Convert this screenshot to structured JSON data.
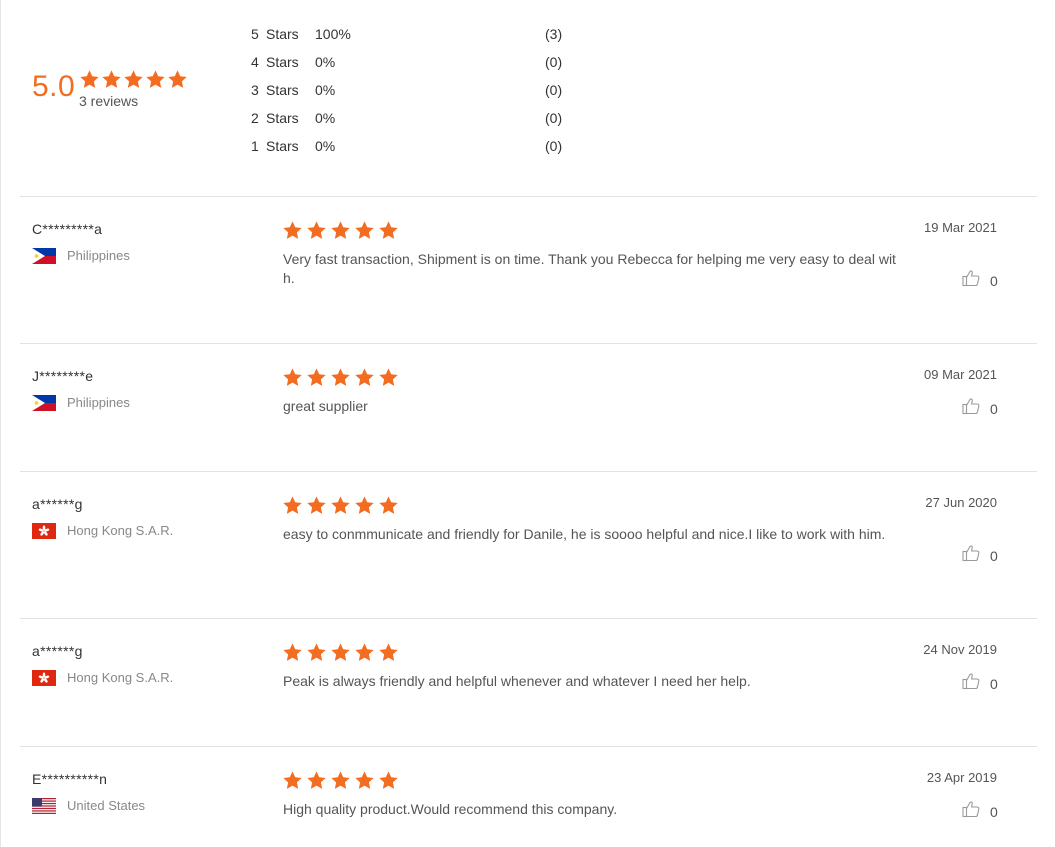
{
  "summary": {
    "score": "5.0",
    "rating": 5,
    "reviews_label": "3 reviews",
    "distribution": [
      {
        "stars": "5",
        "label": "Stars",
        "percent": "100%",
        "count": "(3)"
      },
      {
        "stars": "4",
        "label": "Stars",
        "percent": "0%",
        "count": "(0)"
      },
      {
        "stars": "3",
        "label": "Stars",
        "percent": "0%",
        "count": "(0)"
      },
      {
        "stars": "2",
        "label": "Stars",
        "percent": "0%",
        "count": "(0)"
      },
      {
        "stars": "1",
        "label": "Stars",
        "percent": "0%",
        "count": "(0)"
      }
    ]
  },
  "reviews": [
    {
      "name": "C*********a",
      "country": "Philippines",
      "flag": "philippines-flag-icon",
      "rating": 5,
      "text": "Very fast transaction, Shipment is on time. Thank you Rebecca for helping me very easy to deal with.",
      "date": "19 Mar 2021",
      "likes": "0"
    },
    {
      "name": "J********e",
      "country": "Philippines",
      "flag": "philippines-flag-icon",
      "rating": 5,
      "text": "great supplier",
      "date": "09 Mar 2021",
      "likes": "0"
    },
    {
      "name": "a******g",
      "country": "Hong Kong S.A.R.",
      "flag": "hong-kong-flag-icon",
      "rating": 5,
      "text": "easy to conmmunicate and friendly for Danile, he is soooo helpful and nice.I like to work with him.",
      "date": "27 Jun 2020",
      "likes": "0"
    },
    {
      "name": "a******g",
      "country": "Hong Kong S.A.R.",
      "flag": "hong-kong-flag-icon",
      "rating": 5,
      "text": "Peak is always friendly and helpful whenever and whatever I need her help.",
      "date": "24 Nov 2019",
      "likes": "0"
    },
    {
      "name": "E**********n",
      "country": "United States",
      "flag": "usa-flag-icon",
      "rating": 5,
      "text": "High quality product.Would recommend this company.",
      "date": "23 Apr 2019",
      "likes": "0"
    }
  ],
  "colors": {
    "star": "#f26d21",
    "score": "#f26d21",
    "divider": "#e2e2e2"
  }
}
